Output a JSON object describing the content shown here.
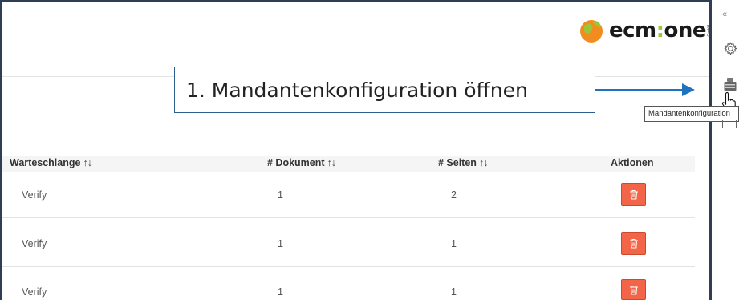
{
  "logo": {
    "brand": "ecm",
    "sep": ":",
    "suffix": "one",
    "gmbh": "GmbH"
  },
  "callout": {
    "text": "1. Mandantenkonfiguration öffnen"
  },
  "sidebar": {
    "collapse_icon": "double-chevron-left",
    "items": [
      {
        "icon": "gear-icon"
      },
      {
        "icon": "tenant-config-icon"
      },
      {
        "icon": "chat-icon"
      }
    ],
    "tooltip": "Mandantenkonfiguration"
  },
  "table": {
    "columns": [
      {
        "label": "Warteschlange",
        "sort": "↑↓"
      },
      {
        "label": "# Dokument",
        "sort": "↑↓"
      },
      {
        "label": "# Seiten",
        "sort": "↑↓"
      },
      {
        "label": "Aktionen",
        "sort": ""
      }
    ],
    "rows": [
      {
        "queue": "Verify",
        "documents": "1",
        "pages": "2"
      },
      {
        "queue": "Verify",
        "documents": "1",
        "pages": "1"
      },
      {
        "queue": "Verify",
        "documents": "1",
        "pages": "1"
      }
    ],
    "delete_icon": "trash-icon"
  },
  "colors": {
    "accent": "#1e73be",
    "delete": "#f26548",
    "frame": "#2f3e55",
    "brand_green": "#9bc43b",
    "brand_orange": "#f28c1e"
  }
}
